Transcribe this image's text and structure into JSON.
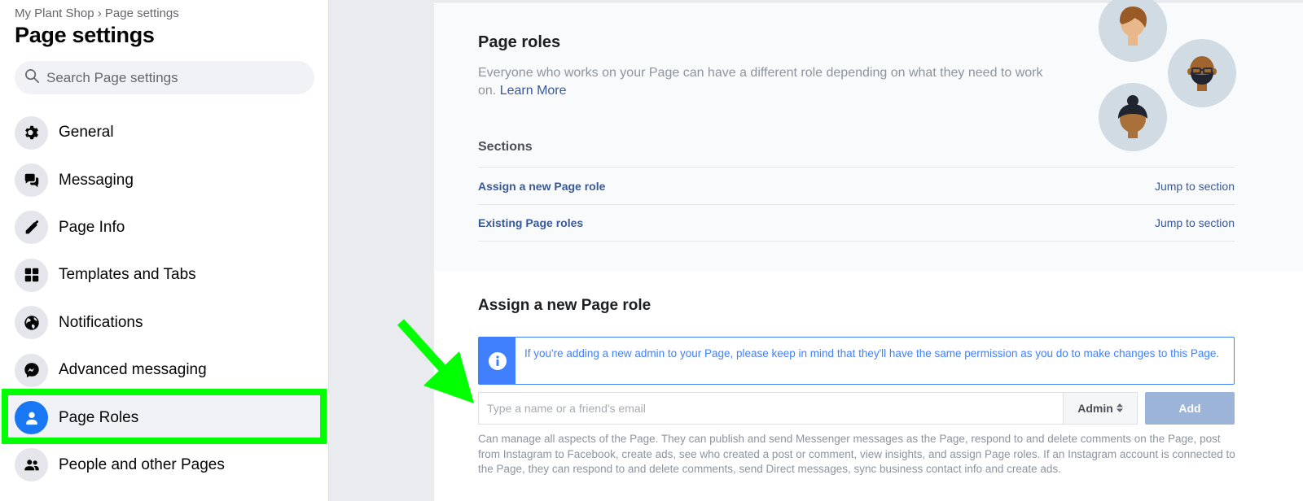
{
  "sidebar": {
    "breadcrumb": "My Plant Shop › Page settings",
    "title": "Page settings",
    "search_placeholder": "Search Page settings",
    "items": [
      {
        "label": "General",
        "icon": "gear-icon"
      },
      {
        "label": "Messaging",
        "icon": "chat-bubbles-icon"
      },
      {
        "label": "Page Info",
        "icon": "pencil-icon"
      },
      {
        "label": "Templates and Tabs",
        "icon": "grid-icon"
      },
      {
        "label": "Notifications",
        "icon": "globe-icon"
      },
      {
        "label": "Advanced messaging",
        "icon": "messenger-icon"
      },
      {
        "label": "Page Roles",
        "icon": "person-icon",
        "active": true
      },
      {
        "label": "People and other Pages",
        "icon": "people-icon"
      }
    ]
  },
  "main": {
    "roles_title": "Page roles",
    "roles_desc": "Everyone who works on your Page can have a different role depending on what they need to work on.",
    "learn_more": "Learn More",
    "sections_title": "Sections",
    "sections": [
      {
        "label": "Assign a new Page role",
        "jump": "Jump to section"
      },
      {
        "label": "Existing Page roles",
        "jump": "Jump to section"
      }
    ],
    "assign_title": "Assign a new Page role",
    "notice": "If you're adding a new admin to your Page, please keep in mind that they'll have the same permission as you do to make changes to this Page.",
    "input_placeholder": "Type a name or a friend's email",
    "input_value": "",
    "role_selected": "Admin",
    "add_label": "Add",
    "role_description": "Can manage all aspects of the Page. They can publish and send Messenger messages as the Page, respond to and delete comments on the Page, post from Instagram to Facebook, create ads, see who created a post or comment, view insights, and assign Page roles. If an Instagram account is connected to the Page, they can respond to and delete comments, send Direct messages, sync business contact info and create ads."
  },
  "colors": {
    "accent": "#1877f2",
    "link": "#385898",
    "notice_blue": "#4080ff",
    "highlight_green": "#00ff00",
    "add_button_disabled": "#9cb4d8"
  }
}
